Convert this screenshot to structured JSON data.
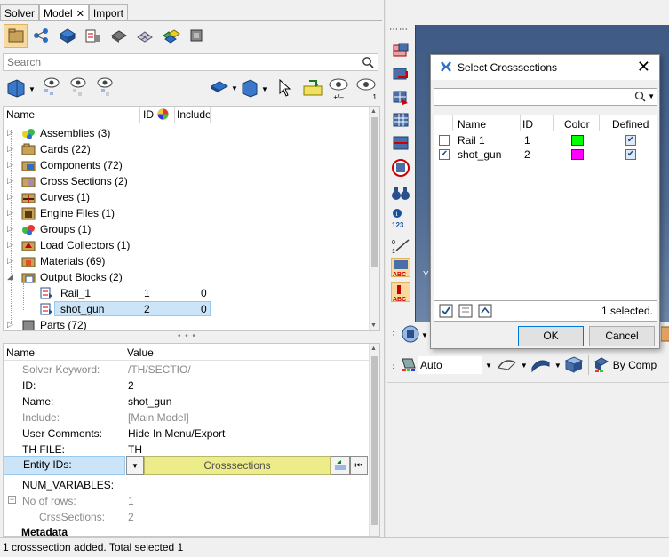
{
  "tabs": [
    {
      "label": "Solver"
    },
    {
      "label": "Model",
      "active": true,
      "closable": true
    },
    {
      "label": "Import"
    }
  ],
  "search": {
    "placeholder": "Search"
  },
  "toolbar_icons": [
    "component-view-icon",
    "connectivity-icon",
    "solids-icon",
    "crosssection-view-icon",
    "tool-view-icon",
    "mesh-view-icon",
    "groups-view-icon",
    "assembly-tool-icon"
  ],
  "tree": {
    "columns": {
      "name": "Name",
      "id": "ID",
      "include": "Include"
    },
    "items": [
      {
        "label": "Assemblies (3)",
        "icon": "assemblies-icon"
      },
      {
        "label": "Cards (22)",
        "icon": "cards-icon"
      },
      {
        "label": "Components (72)",
        "icon": "components-icon"
      },
      {
        "label": "Cross Sections (2)",
        "icon": "cross-sections-icon"
      },
      {
        "label": "Curves (1)",
        "icon": "curves-icon"
      },
      {
        "label": "Engine Files (1)",
        "icon": "engine-files-icon"
      },
      {
        "label": "Groups (1)",
        "icon": "groups-icon"
      },
      {
        "label": "Load Collectors (1)",
        "icon": "load-collectors-icon"
      },
      {
        "label": "Materials (69)",
        "icon": "materials-icon"
      },
      {
        "label": "Output Blocks (2)",
        "icon": "output-blocks-icon",
        "expanded": true
      },
      {
        "label": "Rail_1",
        "id": "1",
        "include": "0",
        "icon": "output-block-icon",
        "child": true
      },
      {
        "label": "shot_gun",
        "id": "2",
        "include": "0",
        "icon": "output-block-icon",
        "child": true,
        "selected": true
      },
      {
        "label": "Parts (72)",
        "icon": "parts-icon"
      }
    ]
  },
  "properties": {
    "columns": {
      "name": "Name",
      "value": "Value"
    },
    "rows": [
      {
        "key": "Solver Keyword:",
        "value": "/TH/SECTIO/",
        "grey": true
      },
      {
        "key": "ID:",
        "value": "2"
      },
      {
        "key": "Name:",
        "value": "shot_gun"
      },
      {
        "key": "Include:",
        "value": "[Main Model]",
        "grey": true
      },
      {
        "key": "User Comments:",
        "value": "Hide In Menu/Export"
      },
      {
        "key": "TH FILE:",
        "value": "TH"
      }
    ],
    "entity_ids": {
      "key": "Entity IDs:",
      "button": "Crosssections"
    },
    "num_variables": {
      "key": "NUM_VARIABLES:"
    },
    "no_of_rows": {
      "key": "No of rows:",
      "value": "1"
    },
    "crss_sections": {
      "key": "CrssSections:",
      "value": "2"
    },
    "metadata": {
      "key": "Metadata"
    }
  },
  "status_bar": {
    "text": "1 crosssection added. Total selected 1"
  },
  "dialog": {
    "title": "Select Crosssections",
    "columns": {
      "name": "Name",
      "id": "ID",
      "color": "Color",
      "defined": "Defined"
    },
    "rows": [
      {
        "name": "Rail 1",
        "id": "1",
        "color": "#00ff00",
        "checked": false,
        "defined": true
      },
      {
        "name": "shot_gun",
        "id": "2",
        "color": "#ff00ff",
        "checked": true,
        "defined": true
      }
    ],
    "selected_text": "1 selected.",
    "ok": "OK",
    "cancel": "Cancel"
  },
  "graphics_toolbar": {
    "auto_label": "Auto",
    "by_comp_label": "By Comp"
  },
  "tree_toolbar_count": "1",
  "tree_toolbar_plusminus": "+/–"
}
